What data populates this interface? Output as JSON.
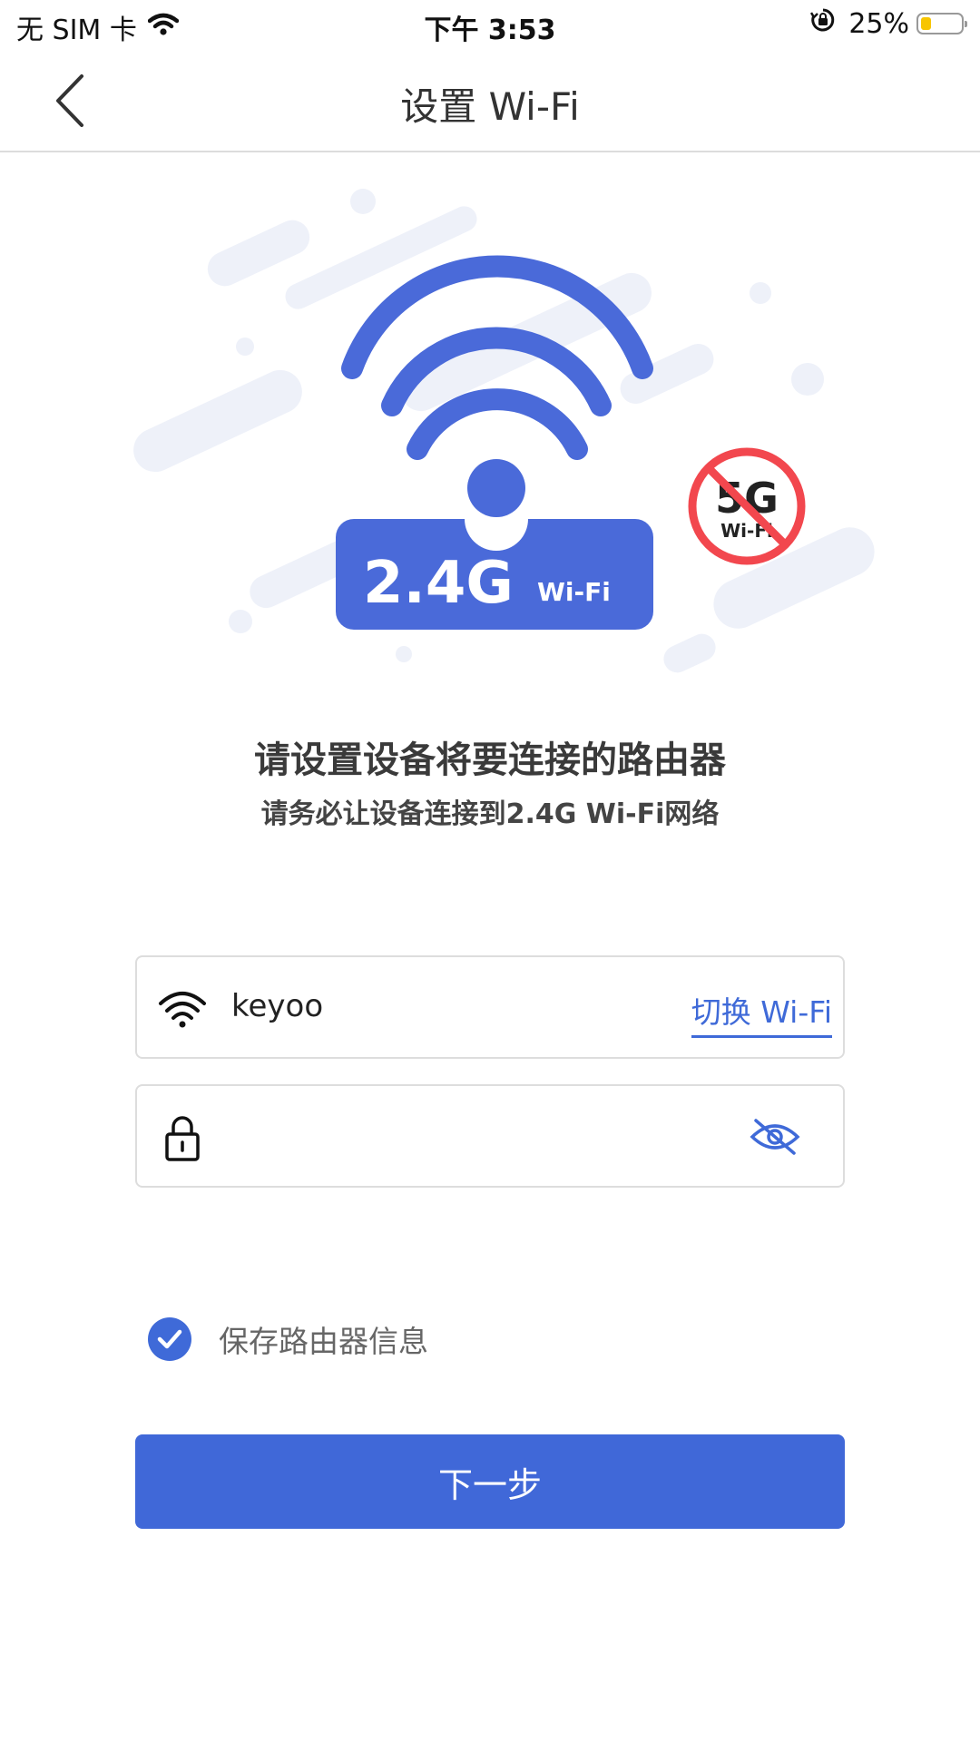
{
  "status_bar": {
    "carrier": "无 SIM 卡",
    "time": "下午 3:53",
    "battery_pct": "25%",
    "battery_level": 0.25
  },
  "nav": {
    "title": "设置 Wi-Fi",
    "back_icon": "chevron-left-icon"
  },
  "illustration": {
    "badge_main": "2.4G",
    "badge_sub": "Wi-Fi",
    "forbidden_main": "5G",
    "forbidden_sub": "Wi-Fi",
    "accent_color": "#4a6ad9",
    "forbidden_color": "#f2474e"
  },
  "headline": "请设置设备将要连接的路由器",
  "subline": "请务必让设备连接到2.4G Wi-Fi网络",
  "ssid_field": {
    "icon": "wifi-icon",
    "value": "keyoo",
    "switch_label": "切换 Wi-Fi"
  },
  "password_field": {
    "icon": "lock-icon",
    "value": "",
    "placeholder": "",
    "toggle_icon": "eye-off-icon"
  },
  "save_checkbox": {
    "checked": true,
    "label": "保存路由器信息"
  },
  "next_button": {
    "label": "下一步"
  },
  "colors": {
    "primary": "#4068d8",
    "border": "#dddddd"
  }
}
